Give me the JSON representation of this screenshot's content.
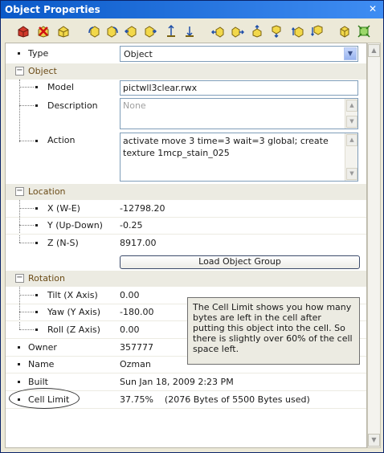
{
  "window": {
    "title": "Object Properties",
    "close_glyph": "✕"
  },
  "toolbar": {
    "icons": [
      "create-object-icon",
      "delete-object-icon",
      "duplicate-object-icon",
      "rotate-left-icon",
      "rotate-right-icon",
      "tilt-forward-icon",
      "tilt-back-icon",
      "snap-up-icon",
      "snap-down-icon",
      "move-left-icon",
      "move-right-icon",
      "move-forward-icon",
      "move-back-icon",
      "raise-icon",
      "lower-icon",
      "object-group-icon",
      "select-all-icon"
    ]
  },
  "properties": {
    "type": {
      "label": "Type",
      "value": "Object",
      "dropdown_glyph": "▼"
    },
    "object_category": "Object",
    "model": {
      "label": "Model",
      "value": "pictwll3clear.rwx"
    },
    "description": {
      "label": "Description",
      "placeholder": "None"
    },
    "action": {
      "label": "Action",
      "value": "activate move 3 time=3 wait=3 global; create texture 1mcp_stain_025"
    },
    "location_category": "Location",
    "x": {
      "label": "X (W-E)",
      "value": "-12798.20"
    },
    "y": {
      "label": "Y (Up-Down)",
      "value": "-0.25"
    },
    "z": {
      "label": "Z (N-S)",
      "value": "8917.00"
    },
    "load_group_button": "Load Object Group",
    "rotation_category": "Rotation",
    "tilt": {
      "label": "Tilt (X Axis)",
      "value": "0.00"
    },
    "yaw": {
      "label": "Yaw (Y Axis)",
      "value": "-180.00"
    },
    "roll": {
      "label": "Roll (Z Axis)",
      "value": "0.00"
    },
    "owner": {
      "label": "Owner",
      "value": "357777"
    },
    "name": {
      "label": "Name",
      "value": "Ozman"
    },
    "built": {
      "label": "Built",
      "value": "Sun Jan 18, 2009 2:23 PM"
    },
    "cell_limit": {
      "label": "Cell Limit",
      "value": "37.75%    (2076 Bytes of 5500 Bytes used)"
    }
  },
  "callout": {
    "text": "The Cell Limit shows you how many bytes are left in the cell after putting this object into the cell.  So there is slightly over 60% of the cell space left."
  },
  "toggles": {
    "collapse": "−"
  },
  "scroll_glyphs": {
    "up": "▲",
    "down": "▼"
  },
  "colors": {
    "titlebar": "#0a59c8",
    "category_bg": "#ecebe2",
    "category_text": "#6b4b17",
    "window_bg": "#ece9d8"
  }
}
